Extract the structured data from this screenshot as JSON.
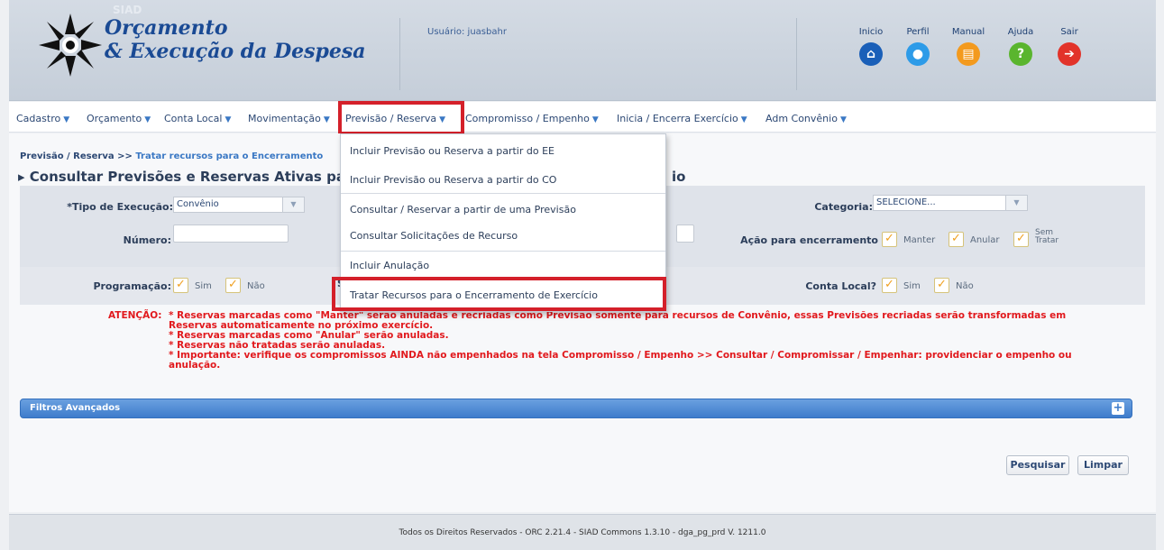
{
  "header": {
    "siad": "SIAD",
    "title_line1": "Orçamento",
    "title_line2": "& Execução da Despesa",
    "user_label": "Usuário: juasbahr",
    "nav": [
      {
        "label": "Inicio",
        "icon": "home-icon",
        "color": "#1a5fb8"
      },
      {
        "label": "Perfil",
        "icon": "user-icon",
        "color": "#2d9be8"
      },
      {
        "label": "Manual",
        "icon": "book-icon",
        "color": "#f39a1e"
      },
      {
        "label": "Ajuda",
        "icon": "help-icon",
        "color": "#5ab52e"
      },
      {
        "label": "Sair",
        "icon": "exit-icon",
        "color": "#e2332a"
      }
    ]
  },
  "menu": [
    "Cadastro",
    "Orçamento",
    "Conta Local",
    "Movimentação",
    "Previsão / Reserva",
    "Compromisso / Empenho",
    "Inicia / Encerra Exercício",
    "Adm Convênio"
  ],
  "breadcrumb": {
    "parent": "Previsão / Reserva >> ",
    "current": "Tratar recursos para o Encerramento"
  },
  "page_title_left": "▸ Consultar Previsões e Reservas Ativas pa",
  "page_title_right": "io",
  "form": {
    "tipo_label": "*Tipo de Execução:",
    "tipo_value": "Convênio",
    "categoria_label": "Categoria:",
    "categoria_value": "SELECIONE...",
    "numero_label": "Número:",
    "acao_label": "Ação para encerramento",
    "acao_opts": [
      "Manter",
      "Anular",
      "Sem\nTratar"
    ],
    "programacao_label": "Programação:",
    "sim": "Sim",
    "nao": "Não",
    "s_label": "S",
    "conta_local_label": "Conta Local?"
  },
  "warning": {
    "label": "ATENÇÃO:",
    "lines": [
      "* Reservas marcadas como \"Manter\" serão anuladas e recriadas como Previsão somente para recursos de Convênio, essas Previsões recriadas serão transformadas em",
      "Reservas automaticamente no próximo exercício.",
      "* Reservas marcadas como \"Anular\" serão anuladas.",
      "* Reservas não tratadas serão anuladas.",
      "* Importante: verifique os compromissos AINDA não empenhados na tela Compromisso / Empenho >> Consultar / Compromissar / Empenhar: providenciar o empenho ou",
      "anulação."
    ]
  },
  "filters_label": "Filtros Avançados",
  "buttons": {
    "search": "Pesquisar",
    "clear": "Limpar"
  },
  "dropdown": [
    "Incluir Previsão ou Reserva a partir do EE",
    "Incluir Previsão ou Reserva a partir do CO",
    "Consultar / Reservar a partir de uma Previsão",
    "Consultar Solicitações de Recurso",
    "Incluir Anulação",
    "Tratar Recursos para o Encerramento de Exercício"
  ],
  "footer": "Todos os Direitos Reservados - ORC 2.21.4 - SIAD Commons 1.3.10 - dga_pg_prd V. 1211.0"
}
